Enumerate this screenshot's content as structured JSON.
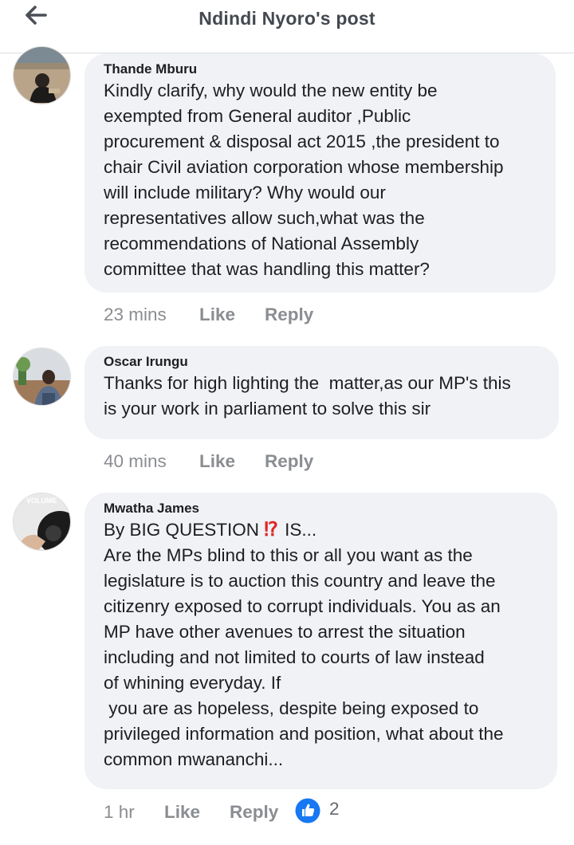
{
  "header": {
    "title": "Ndindi Nyoro's post",
    "back_icon": "arrow-left-icon"
  },
  "comments": [
    {
      "author": "Thande Mburu",
      "text": "Kindly clarify, why would the new entity be\nexempted from General auditor ,Public\nprocurement & disposal act 2015 ,the president to\nchair Civil aviation corporation whose membership\nwill include military? Why would our\nrepresentatives allow such,what was the\nrecommendations of National Assembly\ncommittee that was handling this matter?",
      "time": "23 mins",
      "like_label": "Like",
      "reply_label": "Reply"
    },
    {
      "author": "Oscar Irungu",
      "text": "Thanks for high lighting the  matter,as our MP's this\nis your work in parliament to solve this sir",
      "time": "40 mins",
      "like_label": "Like",
      "reply_label": "Reply"
    },
    {
      "author": "Mwatha James",
      "text_first_prefix": "By BIG QUESTION ",
      "emoji": "⁉",
      "text_first_suffix": " IS...",
      "text": "Are the MPs blind to this or all you want as the\nlegislature is to auction this country and leave the\ncitizenry exposed to corrupt individuals. You as an\nMP have other avenues to arrest the situation\nincluding and not limited to courts of law instead\nof whining everyday. If\n you are as hopeless, despite being exposed to\nprivileged information and position, what about the\ncommon mwananchi...",
      "avatar_text": "VOLUME",
      "time": "1 hr",
      "like_label": "Like",
      "reply_label": "Reply",
      "reaction_icon": "thumbs-up-icon",
      "reaction_count": "2"
    }
  ],
  "colors": {
    "bubble": "#f0f2f5",
    "muted": "#8a8d91",
    "like_blue": "#1877f2"
  }
}
